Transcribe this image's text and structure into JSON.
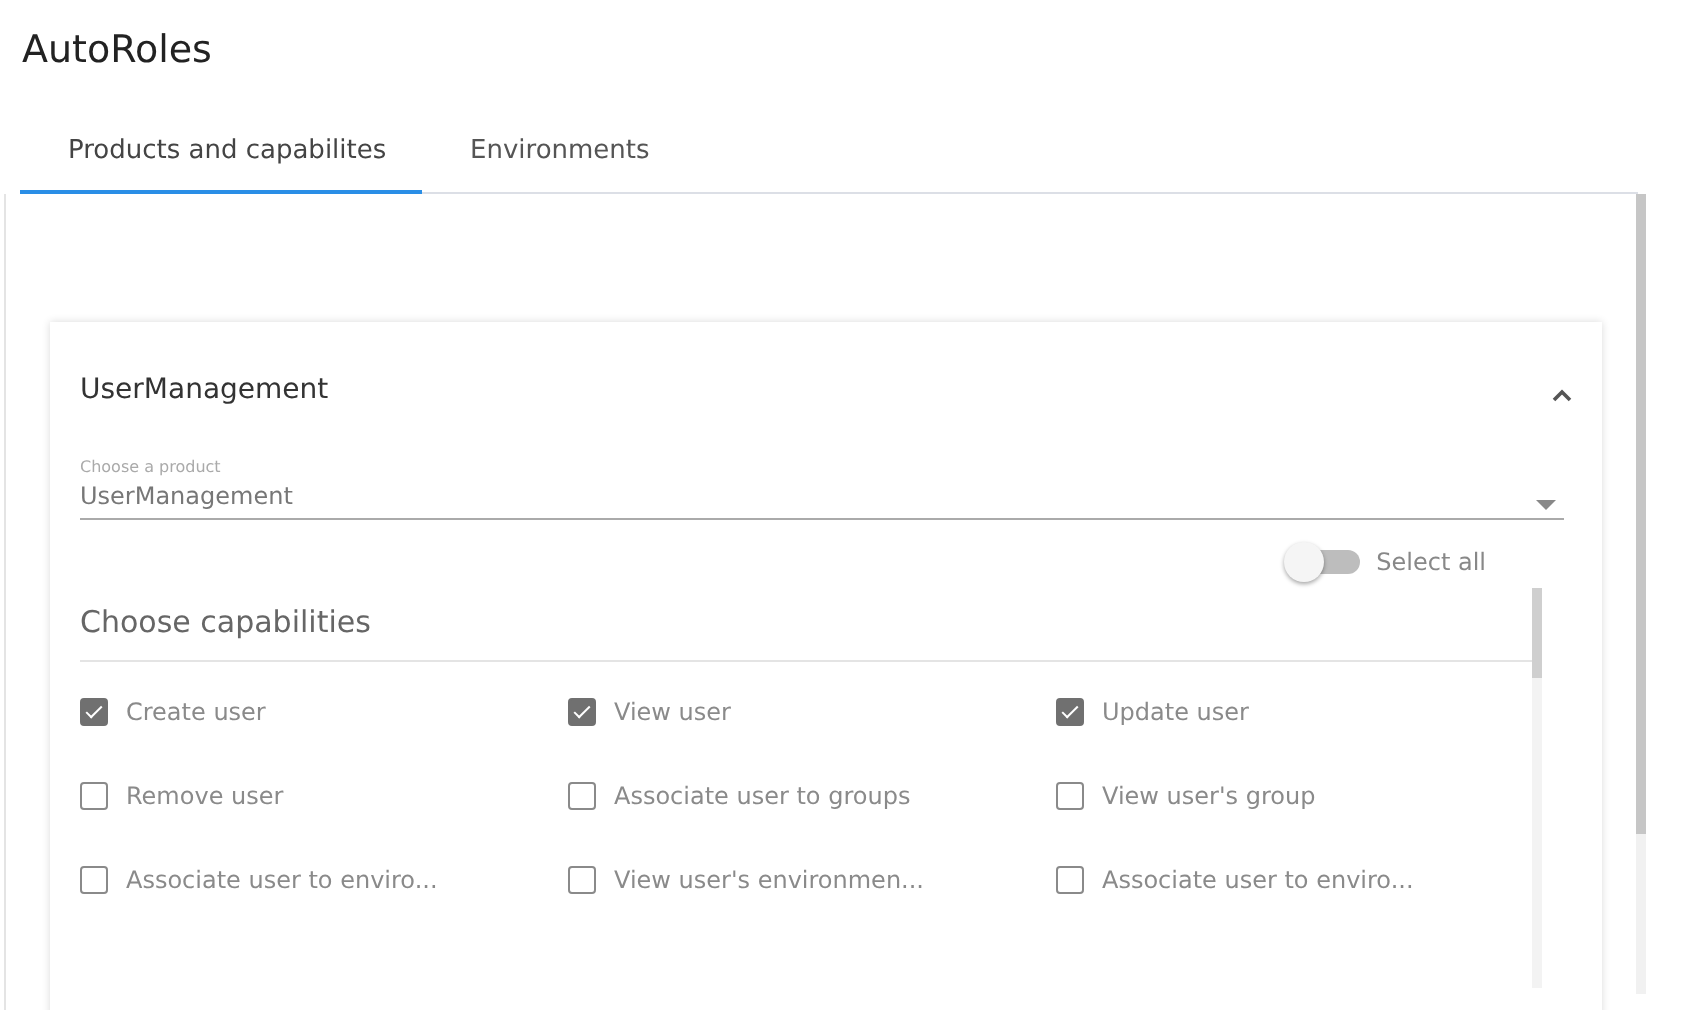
{
  "app": {
    "title": "AutoRoles"
  },
  "tabs": [
    {
      "label": "Products and capabilites",
      "selected": true
    },
    {
      "label": "Environments",
      "selected": false
    }
  ],
  "card": {
    "title": "UserManagement",
    "expanded": true,
    "product_select": {
      "label": "Choose a product",
      "value": "UserManagement"
    },
    "select_all": {
      "label": "Select all",
      "on": false
    },
    "capabilities_heading": "Choose capabilities",
    "capabilities": [
      {
        "label": "Create user",
        "checked": true
      },
      {
        "label": "View user",
        "checked": true
      },
      {
        "label": "Update user",
        "checked": true
      },
      {
        "label": "Remove user",
        "checked": false
      },
      {
        "label": "Associate user to groups",
        "checked": false
      },
      {
        "label": "View user's group",
        "checked": false
      },
      {
        "label": "Associate user to enviro...",
        "checked": false
      },
      {
        "label": "View user's environmen...",
        "checked": false
      },
      {
        "label": "Associate user to enviro...",
        "checked": false
      }
    ]
  }
}
